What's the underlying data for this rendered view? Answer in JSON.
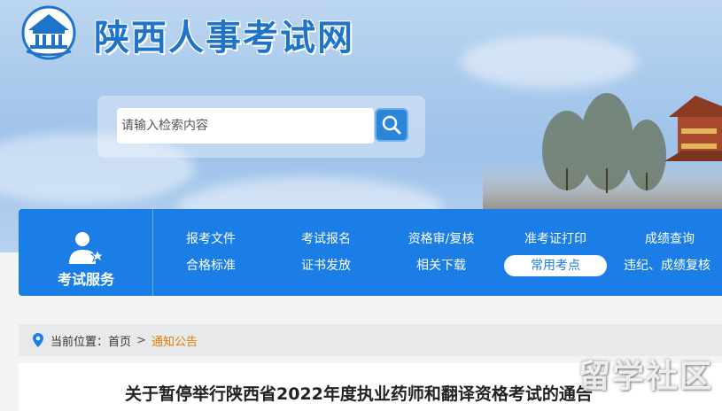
{
  "header": {
    "site_title": "陕西人事考试网",
    "logo_icon": "shaanxi-pavilion-logo"
  },
  "search": {
    "placeholder": "请输入检索内容",
    "button_icon": "search-icon"
  },
  "nav": {
    "service_label": "考试服务",
    "service_icon": "user-star-icon",
    "row1": [
      "报考文件",
      "考试报名",
      "资格审/复核",
      "准考证打印",
      "成绩查询"
    ],
    "row2": [
      "合格标准",
      "证书发放",
      "相关下载",
      "常用考点",
      "违纪、成绩复核"
    ],
    "active": "常用考点"
  },
  "breadcrumb": {
    "prefix": "当前位置：",
    "home": "首页",
    "separator": ">",
    "current": "通知公告"
  },
  "article": {
    "title": "关于暂停举行陕西省2022年度执业药师和翻译资格考试的通告"
  },
  "watermark": {
    "text": "留学社区"
  },
  "colors": {
    "brand_blue": "#1a7ee6",
    "title_blue": "#1f74c9",
    "breadcrumb_current": "#e07d00"
  }
}
